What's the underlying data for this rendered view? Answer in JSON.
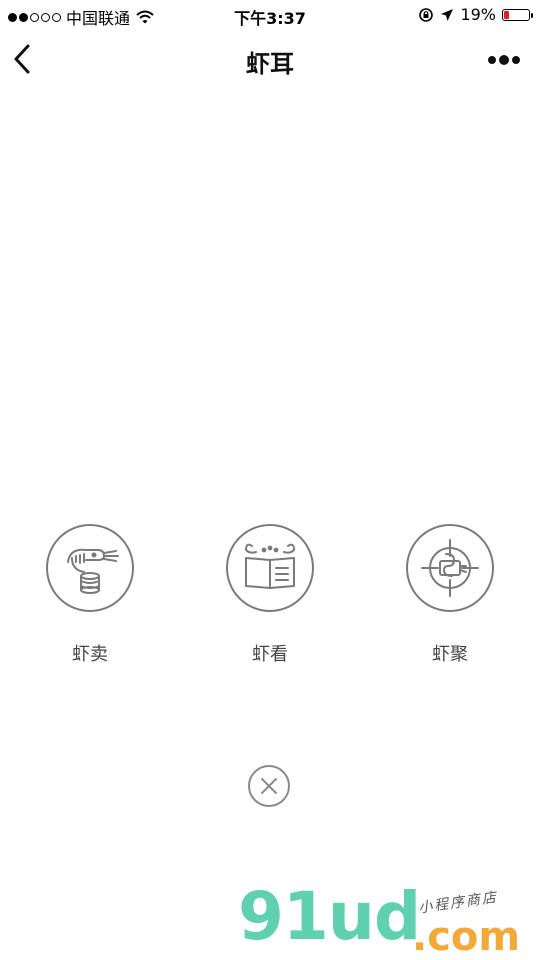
{
  "status_bar": {
    "signal_full": 2,
    "signal_empty": 3,
    "carrier": "中国联通",
    "time": "下午3:37",
    "battery_text": "19%",
    "battery_level": 0.19,
    "icons": [
      "wifi-icon",
      "rotation-lock-icon",
      "location-arrow-icon",
      "battery-icon"
    ]
  },
  "nav": {
    "title": "虾耳",
    "back_icon": "chevron-left-icon",
    "more_icon": "more-dots-icon"
  },
  "menu": {
    "items": [
      {
        "label": "虾卖",
        "icon": "shrimp-coins-icon"
      },
      {
        "label": "虾看",
        "icon": "crab-book-icon"
      },
      {
        "label": "虾聚",
        "icon": "target-shrimp-icon"
      }
    ]
  },
  "close": {
    "icon": "close-icon"
  },
  "watermark": {
    "main": "91ud",
    "com": ".com",
    "tag": "小程序商店"
  },
  "colors": {
    "icon_stroke": "#7a7a7a",
    "battery_low": "#e02020",
    "watermark_green": "#5fd0b0",
    "watermark_orange": "#f3a83a"
  }
}
